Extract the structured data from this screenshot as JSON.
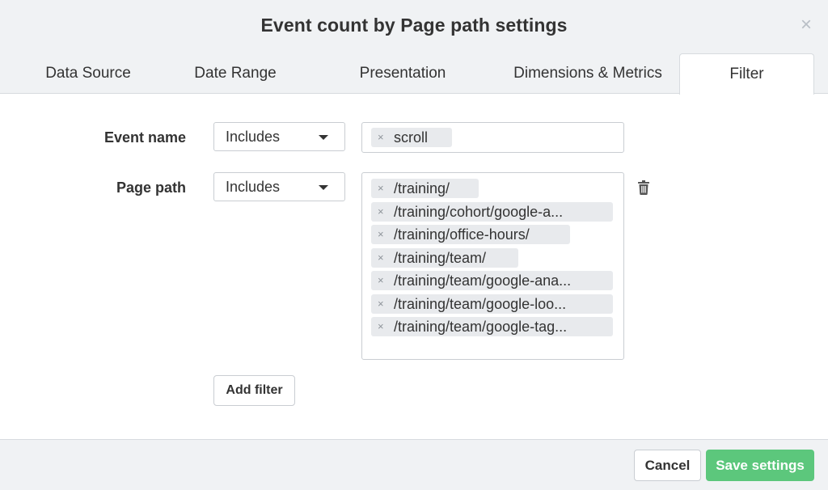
{
  "dialog": {
    "title": "Event count by Page path settings",
    "close_symbol": "×"
  },
  "tabs": [
    {
      "label": "Data Source"
    },
    {
      "label": "Date Range"
    },
    {
      "label": "Presentation"
    },
    {
      "label": "Dimensions & Metrics"
    },
    {
      "label": "Filter",
      "active": true
    }
  ],
  "filters": [
    {
      "label": "Event name",
      "operator": "Includes",
      "values": [
        "scroll"
      ]
    },
    {
      "label": "Page path",
      "operator": "Includes",
      "values": [
        "/training/",
        "/training/cohort/google-a...",
        "/training/office-hours/",
        "/training/team/",
        "/training/team/google-ana...",
        "/training/team/google-loo...",
        "/training/team/google-tag..."
      ]
    }
  ],
  "tag_remove_symbol": "×",
  "add_filter_label": "Add filter",
  "footer": {
    "cancel_label": "Cancel",
    "save_label": "Save settings"
  },
  "icons": {
    "close": "close-icon",
    "caret": "chevron-down-icon",
    "trash": "trash-icon",
    "remove": "remove-tag-icon"
  },
  "colors": {
    "primary": "#5cc77c",
    "header_bg": "#f0f2f4",
    "tag_bg": "#e8eaed"
  }
}
